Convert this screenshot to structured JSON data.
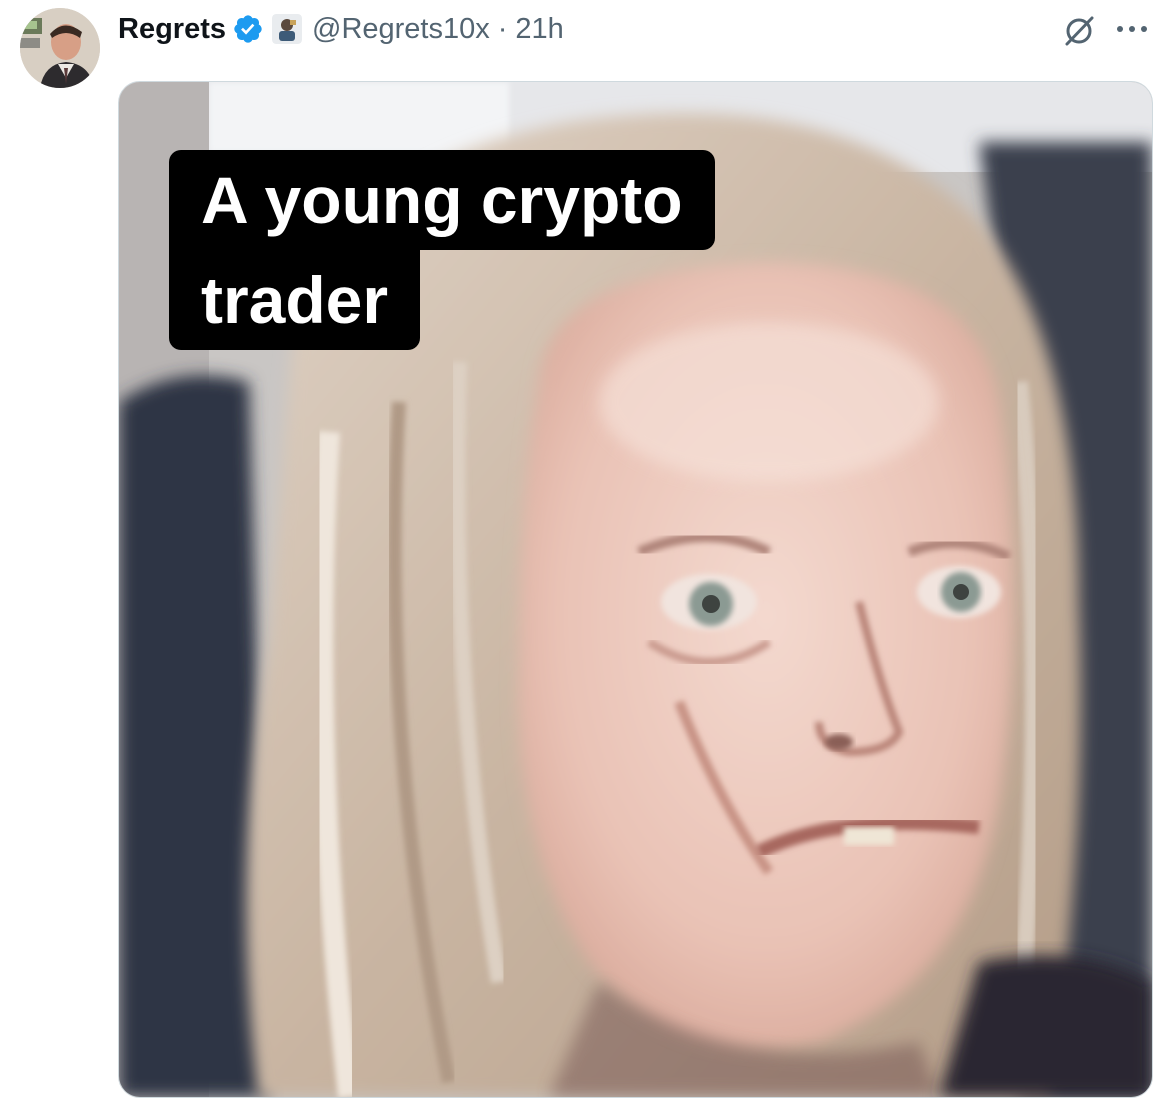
{
  "tweet": {
    "display_name": "Regrets",
    "handle": "@Regrets10x",
    "separator": "·",
    "timestamp": "21h",
    "verified": true
  },
  "media": {
    "caption_line_1": "A young crypto",
    "caption_line_2": "trader"
  },
  "icons": {
    "verified": "verified-badge-icon",
    "affiliation": "affiliate-badge-icon",
    "grok": "grok-icon",
    "more": "more-icon"
  },
  "colors": {
    "text": "#0f1419",
    "secondary_text": "#536471",
    "verified_blue": "#1d9bf0",
    "caption_bg": "#000000",
    "caption_text": "#ffffff"
  }
}
